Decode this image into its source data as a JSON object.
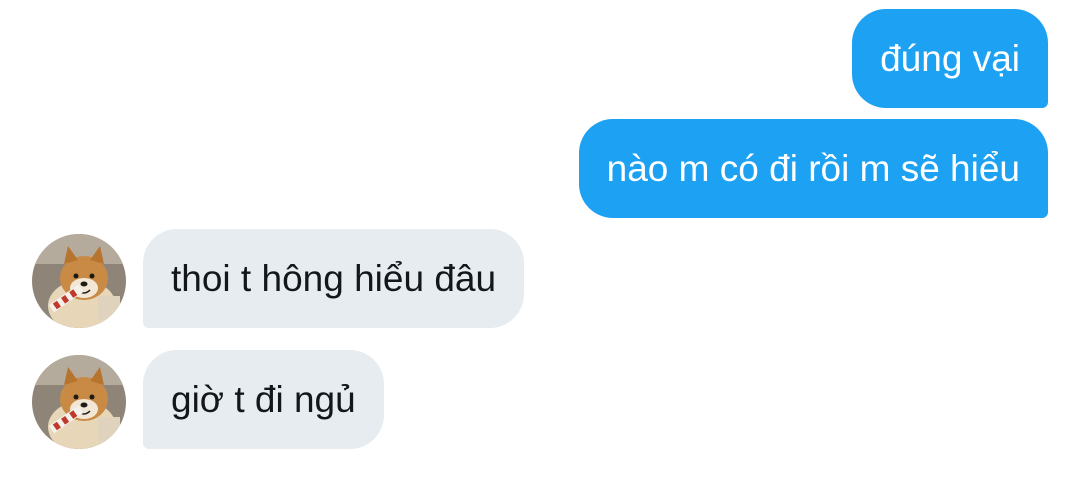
{
  "messages": [
    {
      "direction": "outgoing",
      "text": "đúng vại"
    },
    {
      "direction": "outgoing",
      "text": "nào m có đi rồi m sẽ hiểu"
    },
    {
      "direction": "incoming",
      "text": "thoi t hông hiểu đâu",
      "avatar": "shiba-dog-avatar"
    },
    {
      "direction": "incoming",
      "text": "giờ t đi ngủ",
      "avatar": "shiba-dog-avatar"
    }
  ],
  "colors": {
    "outgoing_bubble": "#1da1f2",
    "incoming_bubble": "#e6ecf0",
    "outgoing_text": "#ffffff",
    "incoming_text": "#14171a",
    "background": "#ffffff"
  }
}
